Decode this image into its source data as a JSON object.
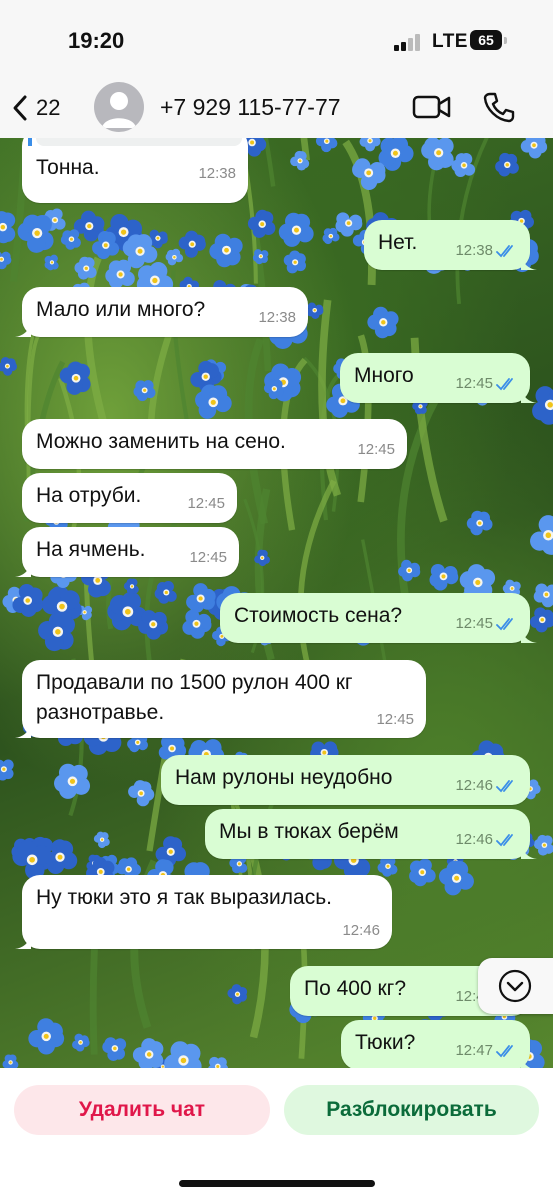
{
  "status_bar": {
    "time": "19:20",
    "network": "LTE",
    "battery": "65"
  },
  "header": {
    "back_count": "22",
    "contact_name": "+7 929 115-77-77",
    "icons": {
      "back": "chevron-left-icon",
      "avatar": "person-icon",
      "video": "video-camera-icon",
      "call": "phone-icon"
    }
  },
  "messages": [
    {
      "dir": "in",
      "text": "Тонна.",
      "time": "12:38"
    },
    {
      "dir": "out",
      "text": "Нет.",
      "time": "12:38",
      "status": "read"
    },
    {
      "dir": "in",
      "text": "Мало или много?",
      "time": "12:38"
    },
    {
      "dir": "out",
      "text": "Много",
      "time": "12:45",
      "status": "read"
    },
    {
      "dir": "in",
      "text": "Можно заменить на сено.",
      "time": "12:45"
    },
    {
      "dir": "in",
      "text": "На отруби.",
      "time": "12:45"
    },
    {
      "dir": "in",
      "text": "На ячмень.",
      "time": "12:45"
    },
    {
      "dir": "out",
      "text": "Стоимость сена?",
      "time": "12:45",
      "status": "read"
    },
    {
      "dir": "in",
      "text": "Продавали по 1500 рулон 400 кг\nразнотравье.",
      "time": "12:45"
    },
    {
      "dir": "out",
      "text": "Нам рулоны неудобно",
      "time": "12:46",
      "status": "read"
    },
    {
      "dir": "out",
      "text": "Мы в тюках берём",
      "time": "12:46",
      "status": "read"
    },
    {
      "dir": "in",
      "text": "Ну тюки это я так выразилась.",
      "time": "12:46"
    },
    {
      "dir": "out",
      "text": "По 400 кг?",
      "time": "12:47",
      "status": "read"
    },
    {
      "dir": "out",
      "text": "Тюки?",
      "time": "12:47",
      "status": "read"
    }
  ],
  "actions": {
    "delete_label": "Удалить чат",
    "unblock_label": "Разблокировать"
  },
  "colors": {
    "incoming": "#ffffff",
    "outgoing": "#d9fdd3",
    "read_ticks": "#3b8ee8",
    "delete": "#e0174a",
    "unblock": "#0b6b3a"
  }
}
